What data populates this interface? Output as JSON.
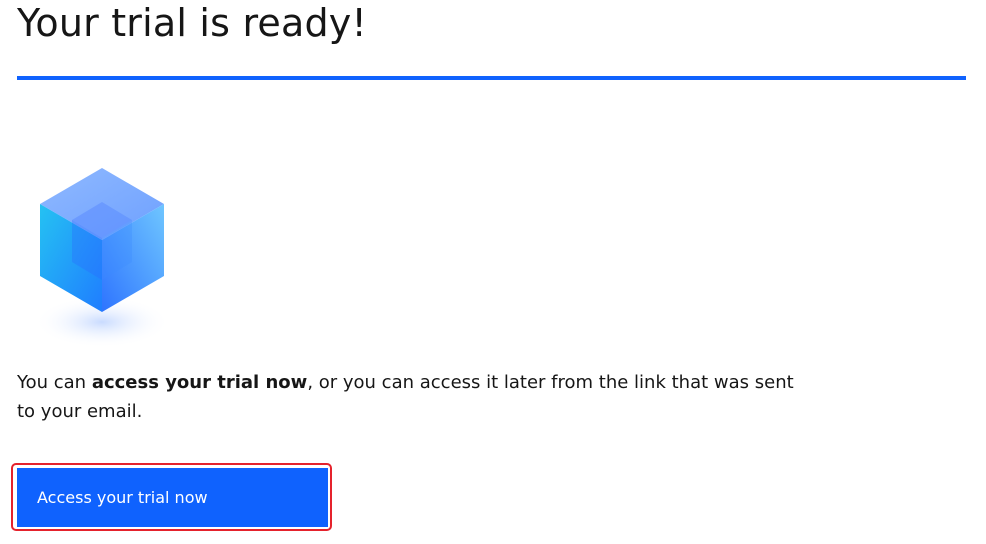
{
  "header": {
    "title": "Your trial is ready!"
  },
  "illustration": {
    "icon": "cube-icon",
    "colors": {
      "top": "#7ab2ff",
      "left": "#1aa7ef",
      "right": "#4d8bff",
      "shadow": "#dce7ff"
    }
  },
  "message": {
    "prefix": "You can ",
    "emphasis": "access your trial now",
    "suffix": ", or you can access it later from the link that was sent to your email."
  },
  "actions": {
    "primary_label": "Access your trial now"
  },
  "colors": {
    "accent": "#0f62fe",
    "highlight_outline": "#e5222c",
    "text": "#161616"
  }
}
